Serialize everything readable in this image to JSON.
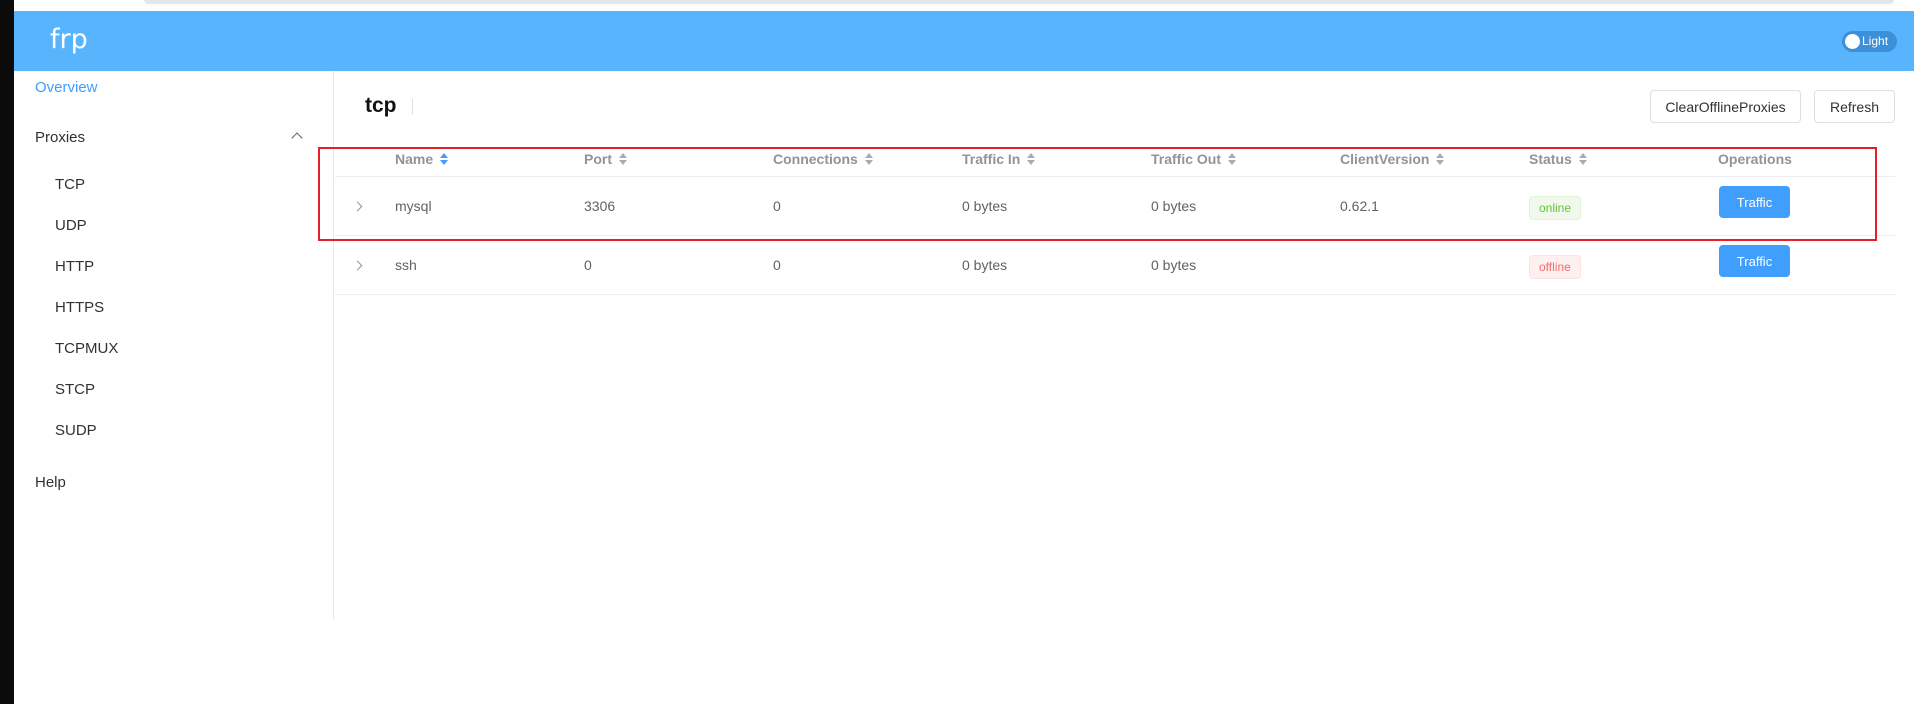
{
  "app": {
    "title": "frp",
    "theme_label": "Light"
  },
  "sidebar": {
    "overview": "Overview",
    "proxies": "Proxies",
    "proxy_types": [
      "TCP",
      "UDP",
      "HTTP",
      "HTTPS",
      "TCPMUX",
      "STCP",
      "SUDP"
    ],
    "help": "Help"
  },
  "main": {
    "title": "tcp",
    "buttons": {
      "clear": "ClearOfflineProxies",
      "refresh": "Refresh"
    },
    "columns": [
      "Name",
      "Port",
      "Connections",
      "Traffic In",
      "Traffic Out",
      "ClientVersion",
      "Status",
      "Operations"
    ],
    "rows": [
      {
        "name": "mysql",
        "port": "3306",
        "connections": "0",
        "traffic_in": "0 bytes",
        "traffic_out": "0 bytes",
        "client_version": "0.62.1",
        "status": "online",
        "operation": "Traffic"
      },
      {
        "name": "ssh",
        "port": "0",
        "connections": "0",
        "traffic_in": "0 bytes",
        "traffic_out": "0 bytes",
        "client_version": "",
        "status": "offline",
        "operation": "Traffic"
      }
    ]
  },
  "colors": {
    "header": "#58b5fd",
    "accent": "#409eff",
    "highlight": "#e6202a",
    "online": "#67c23a",
    "offline": "#f56c6c"
  }
}
